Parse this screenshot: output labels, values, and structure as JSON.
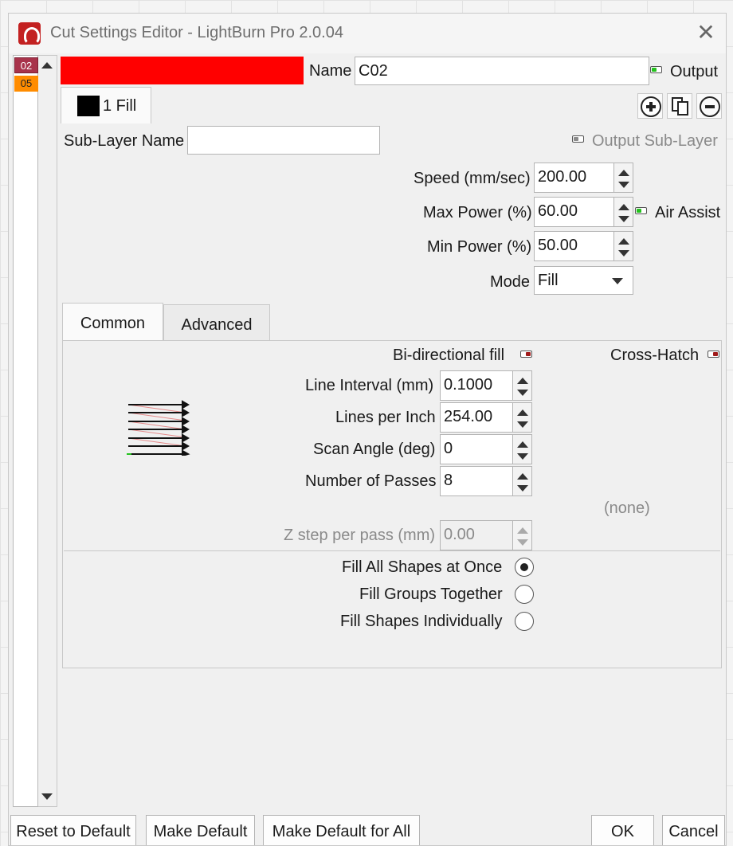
{
  "window": {
    "title": "Cut Settings Editor - LightBurn Pro 2.0.04"
  },
  "layers": [
    {
      "label": "02",
      "color": "#a8334b"
    },
    {
      "label": "05",
      "color": "#ff8c00"
    }
  ],
  "header": {
    "layer_color": "#ff0000",
    "name_label": "Name",
    "name_value": "C02",
    "output_label": "Output",
    "output_on": true
  },
  "sublayer_tabs": [
    {
      "label": "1 Fill",
      "swatch_color": "#000000"
    }
  ],
  "sublayer": {
    "name_label": "Sub-Layer Name",
    "name_value": "",
    "output_label": "Output Sub-Layer"
  },
  "params": {
    "speed_label": "Speed (mm/sec)",
    "speed_value": "200.00",
    "max_power_label": "Max Power (%)",
    "max_power_value": "60.00",
    "air_assist_label": "Air Assist",
    "air_assist_on": true,
    "min_power_label": "Min Power (%)",
    "min_power_value": "50.00",
    "mode_label": "Mode",
    "mode_value": "Fill"
  },
  "tabs": [
    {
      "label": "Common",
      "active": true
    },
    {
      "label": "Advanced",
      "active": false
    }
  ],
  "common": {
    "bidirectional_label": "Bi-directional fill",
    "bidirectional_on": false,
    "crosshatch_label": "Cross-Hatch",
    "crosshatch_on": false,
    "line_interval_label": "Line Interval (mm)",
    "line_interval_value": "0.1000",
    "lpi_label": "Lines per Inch",
    "lpi_value": "254.00",
    "scan_angle_label": "Scan Angle (deg)",
    "scan_angle_value": "0",
    "passes_label": "Number of Passes",
    "passes_value": "8",
    "none_label": "(none)",
    "zstep_label": "Z step per pass (mm)",
    "zstep_value": "0.00",
    "fill_all_label": "Fill All Shapes at Once",
    "fill_groups_label": "Fill Groups Together",
    "fill_individual_label": "Fill Shapes Individually",
    "fill_option_selected": "all"
  },
  "footer": {
    "reset_label": "Reset to Default",
    "make_default_label": "Make Default",
    "make_default_all_label": "Make Default for All",
    "ok_label": "OK",
    "cancel_label": "Cancel"
  }
}
